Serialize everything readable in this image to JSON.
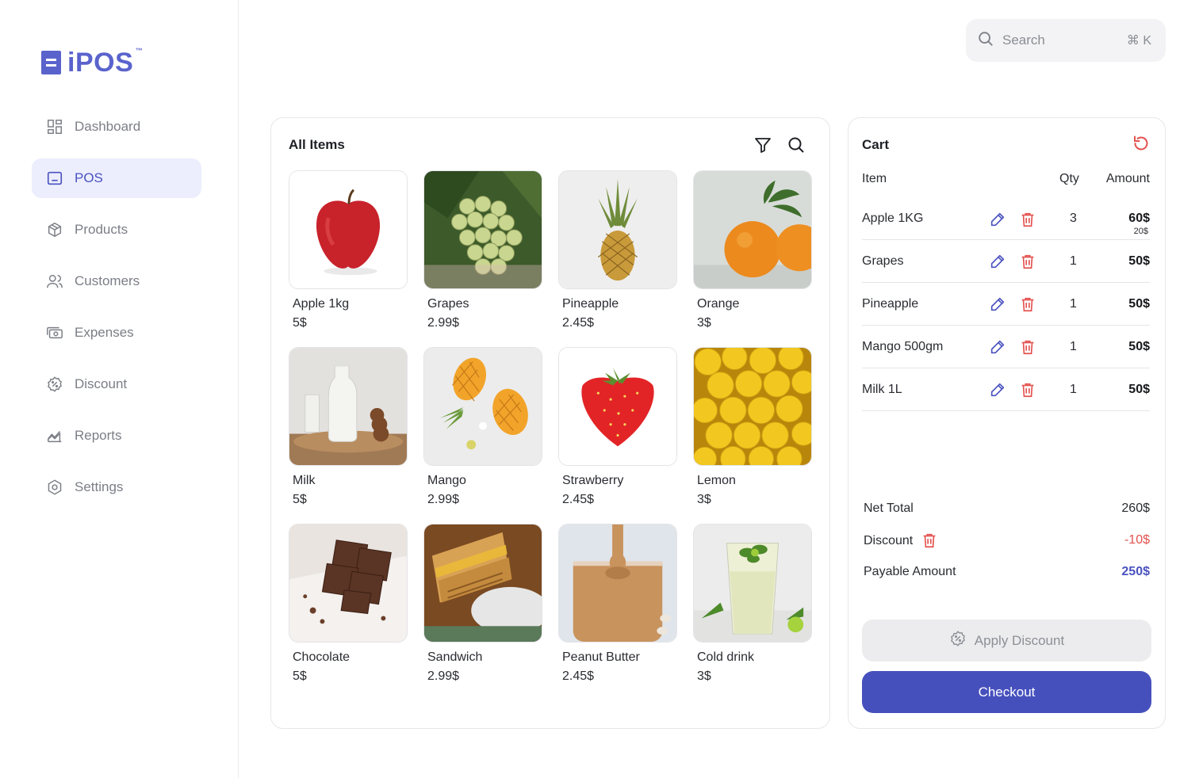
{
  "app": {
    "logo_text": "iPOS",
    "logo_tm": "™"
  },
  "colors": {
    "accent": "#4650bd",
    "brand": "#5a63cc",
    "danger": "#e3524f",
    "active_bg": "#eceefd"
  },
  "sidebar": {
    "items": [
      {
        "label": "Dashboard",
        "icon": "dashboard-icon",
        "active": false
      },
      {
        "label": "POS",
        "icon": "pos-icon",
        "active": true
      },
      {
        "label": "Products",
        "icon": "box-icon",
        "active": false
      },
      {
        "label": "Customers",
        "icon": "users-icon",
        "active": false
      },
      {
        "label": "Expenses",
        "icon": "cash-icon",
        "active": false
      },
      {
        "label": "Discount",
        "icon": "discount-icon",
        "active": false
      },
      {
        "label": "Reports",
        "icon": "chart-icon",
        "active": false
      },
      {
        "label": "Settings",
        "icon": "settings-icon",
        "active": false
      }
    ]
  },
  "search": {
    "placeholder": "Search",
    "shortcut": "⌘ K"
  },
  "items_panel": {
    "title": "All Items",
    "products": [
      {
        "name": "Apple 1kg",
        "price": "5$"
      },
      {
        "name": "Grapes",
        "price": "2.99$"
      },
      {
        "name": "Pineapple",
        "price": "2.45$"
      },
      {
        "name": "Orange",
        "price": "3$"
      },
      {
        "name": "Milk",
        "price": "5$"
      },
      {
        "name": "Mango",
        "price": "2.99$"
      },
      {
        "name": "Strawberry",
        "price": "2.45$"
      },
      {
        "name": "Lemon",
        "price": "3$"
      },
      {
        "name": "Chocolate",
        "price": "5$"
      },
      {
        "name": "Sandwich",
        "price": "2.99$"
      },
      {
        "name": "Peanut Butter",
        "price": "2.45$"
      },
      {
        "name": "Cold drink",
        "price": "3$"
      }
    ]
  },
  "cart": {
    "title": "Cart",
    "headers": {
      "item": "Item",
      "qty": "Qty",
      "amount": "Amount"
    },
    "rows": [
      {
        "name": "Apple 1KG",
        "qty": "3",
        "amount": "60$",
        "unit": "20$"
      },
      {
        "name": "Grapes",
        "qty": "1",
        "amount": "50$"
      },
      {
        "name": "Pineapple",
        "qty": "1",
        "amount": "50$"
      },
      {
        "name": "Mango 500gm",
        "qty": "1",
        "amount": "50$"
      },
      {
        "name": "Milk 1L",
        "qty": "1",
        "amount": "50$"
      }
    ],
    "net_total_label": "Net Total",
    "net_total": "260$",
    "discount_label": "Discount",
    "discount": "-10$",
    "payable_label": "Payable Amount",
    "payable": "250$",
    "apply_discount_label": "Apply Discount",
    "checkout_label": "Checkout"
  }
}
